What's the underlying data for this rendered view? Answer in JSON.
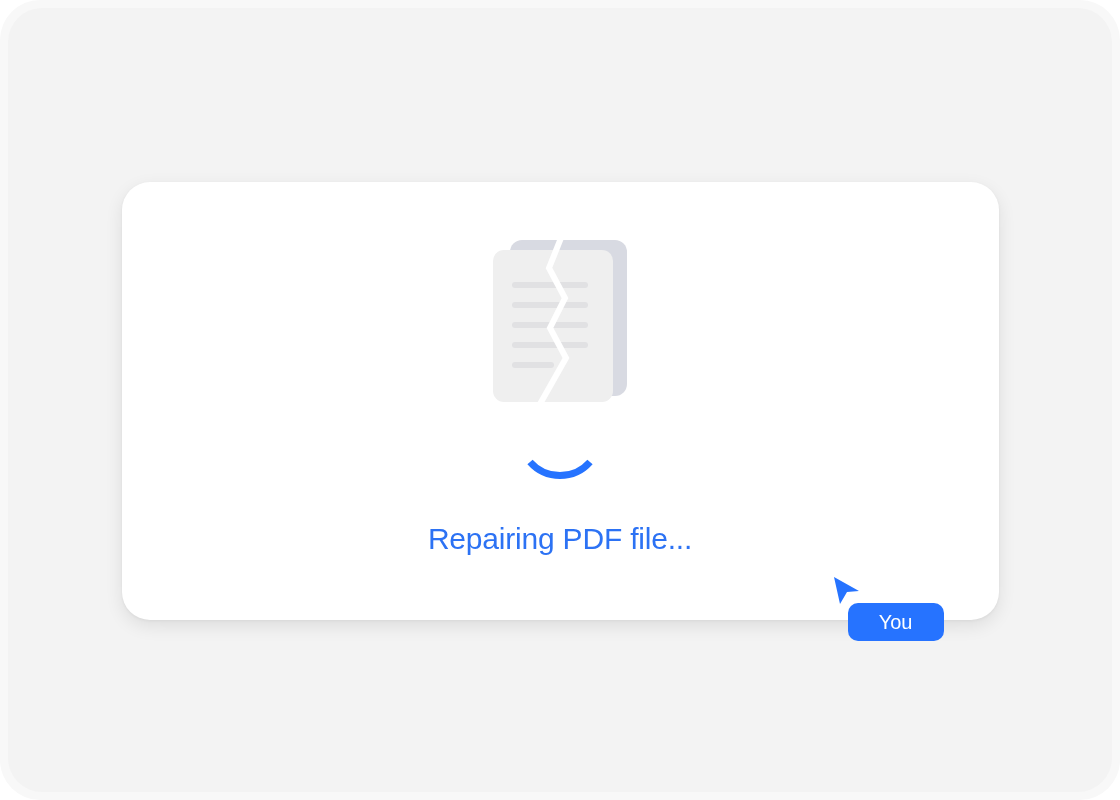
{
  "status": {
    "message": "Repairing PDF file..."
  },
  "cursor": {
    "label": "You"
  }
}
